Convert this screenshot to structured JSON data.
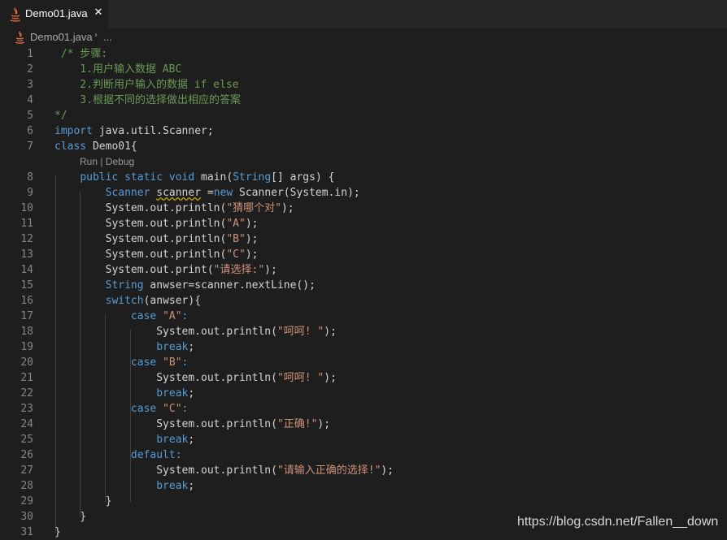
{
  "tab": {
    "filename": "Demo01.java",
    "close_glyph": "✕",
    "icon": "java-icon"
  },
  "breadcrumb": {
    "file": "Demo01.java",
    "separator": "›",
    "more": "..."
  },
  "codelens": {
    "text": "Run | Debug"
  },
  "gutter": [
    "1",
    "2",
    "3",
    "4",
    "5",
    "6",
    "7",
    "8",
    "9",
    "10",
    "11",
    "12",
    "13",
    "14",
    "15",
    "16",
    "17",
    "18",
    "19",
    "20",
    "21",
    "22",
    "23",
    "24",
    "25",
    "26",
    "27",
    "28",
    "29",
    "30",
    "31"
  ],
  "code": {
    "l1": [
      {
        "t": " /* 步骤:",
        "c": "c"
      }
    ],
    "l2": [
      {
        "t": "    1.用户输入数据 ABC",
        "c": "c"
      }
    ],
    "l3": [
      {
        "t": "    2.判断用户输入的数据 if else",
        "c": "c"
      }
    ],
    "l4": [
      {
        "t": "    3.根据不同的选择做出相应的答案",
        "c": "c"
      }
    ],
    "l5": [
      {
        "t": "*/",
        "c": "c"
      }
    ],
    "l6": [
      {
        "t": "import",
        "c": "k"
      },
      {
        "t": " java.util.Scanner;"
      }
    ],
    "l7": [
      {
        "t": "class",
        "c": "k"
      },
      {
        "t": " Demo01{"
      }
    ],
    "l8": [
      {
        "t": "    "
      },
      {
        "t": "public",
        "c": "k"
      },
      {
        "t": " "
      },
      {
        "t": "static",
        "c": "k"
      },
      {
        "t": " "
      },
      {
        "t": "void",
        "c": "k"
      },
      {
        "t": " main("
      },
      {
        "t": "String",
        "c": "k"
      },
      {
        "t": "[] args) {"
      }
    ],
    "l9": [
      {
        "t": "        "
      },
      {
        "t": "Scanner",
        "c": "k"
      },
      {
        "t": " "
      },
      {
        "t": "scanner",
        "c": "sq"
      },
      {
        "t": " ="
      },
      {
        "t": "new",
        "c": "k"
      },
      {
        "t": " Scanner(System.in);"
      }
    ],
    "l10": [
      {
        "t": "        System.out.println("
      },
      {
        "t": "\"猜哪个对\"",
        "c": "s"
      },
      {
        "t": ");"
      }
    ],
    "l11": [
      {
        "t": "        System.out.println("
      },
      {
        "t": "\"A\"",
        "c": "s"
      },
      {
        "t": ");"
      }
    ],
    "l12": [
      {
        "t": "        System.out.println("
      },
      {
        "t": "\"B\"",
        "c": "s"
      },
      {
        "t": ");"
      }
    ],
    "l13": [
      {
        "t": "        System.out.println("
      },
      {
        "t": "\"C\"",
        "c": "s"
      },
      {
        "t": ");"
      }
    ],
    "l14": [
      {
        "t": "        System.out.print("
      },
      {
        "t": "\"请选择:\"",
        "c": "s"
      },
      {
        "t": ");"
      }
    ],
    "l15": [
      {
        "t": "        "
      },
      {
        "t": "String",
        "c": "k"
      },
      {
        "t": " anwser=scanner.nextLine();"
      }
    ],
    "l16": [
      {
        "t": "        "
      },
      {
        "t": "switch",
        "c": "k"
      },
      {
        "t": "(anwser){"
      }
    ],
    "l17": [
      {
        "t": "            "
      },
      {
        "t": "case",
        "c": "k"
      },
      {
        "t": " "
      },
      {
        "t": "\"A\"",
        "c": "s"
      },
      {
        "t": ":",
        "c": "k"
      }
    ],
    "l18": [
      {
        "t": "                System.out.println("
      },
      {
        "t": "\"呵呵! \"",
        "c": "s"
      },
      {
        "t": ");"
      }
    ],
    "l19": [
      {
        "t": "                "
      },
      {
        "t": "break",
        "c": "k"
      },
      {
        "t": ";"
      }
    ],
    "l20": [
      {
        "t": "            "
      },
      {
        "t": "case",
        "c": "k"
      },
      {
        "t": " "
      },
      {
        "t": "\"B\"",
        "c": "s"
      },
      {
        "t": ":",
        "c": "k"
      }
    ],
    "l21": [
      {
        "t": "                System.out.println("
      },
      {
        "t": "\"呵呵! \"",
        "c": "s"
      },
      {
        "t": ");"
      }
    ],
    "l22": [
      {
        "t": "                "
      },
      {
        "t": "break",
        "c": "k"
      },
      {
        "t": ";"
      }
    ],
    "l23": [
      {
        "t": "            "
      },
      {
        "t": "case",
        "c": "k"
      },
      {
        "t": " "
      },
      {
        "t": "\"C\"",
        "c": "s"
      },
      {
        "t": ":",
        "c": "k"
      }
    ],
    "l24": [
      {
        "t": "                System.out.println("
      },
      {
        "t": "\"正确!\"",
        "c": "s"
      },
      {
        "t": ");"
      }
    ],
    "l25": [
      {
        "t": "                "
      },
      {
        "t": "break",
        "c": "k"
      },
      {
        "t": ";"
      }
    ],
    "l26": [
      {
        "t": "            "
      },
      {
        "t": "default:",
        "c": "k"
      }
    ],
    "l27": [
      {
        "t": "                System.out.println("
      },
      {
        "t": "\"请输入正确的选择!\"",
        "c": "s"
      },
      {
        "t": ");"
      }
    ],
    "l28": [
      {
        "t": "                "
      },
      {
        "t": "break",
        "c": "k"
      },
      {
        "t": ";"
      }
    ],
    "l29": [
      {
        "t": "        }"
      }
    ],
    "l30": [
      {
        "t": "    }"
      }
    ],
    "l31": [
      {
        "t": "}"
      }
    ]
  },
  "watermark": "https://blog.csdn.net/Fallen__down",
  "colors": {
    "background": "#1e1e1e",
    "keyword": "#569cd6",
    "comment": "#6a9955",
    "string": "#ce9178",
    "squiggle": "#cca700"
  }
}
